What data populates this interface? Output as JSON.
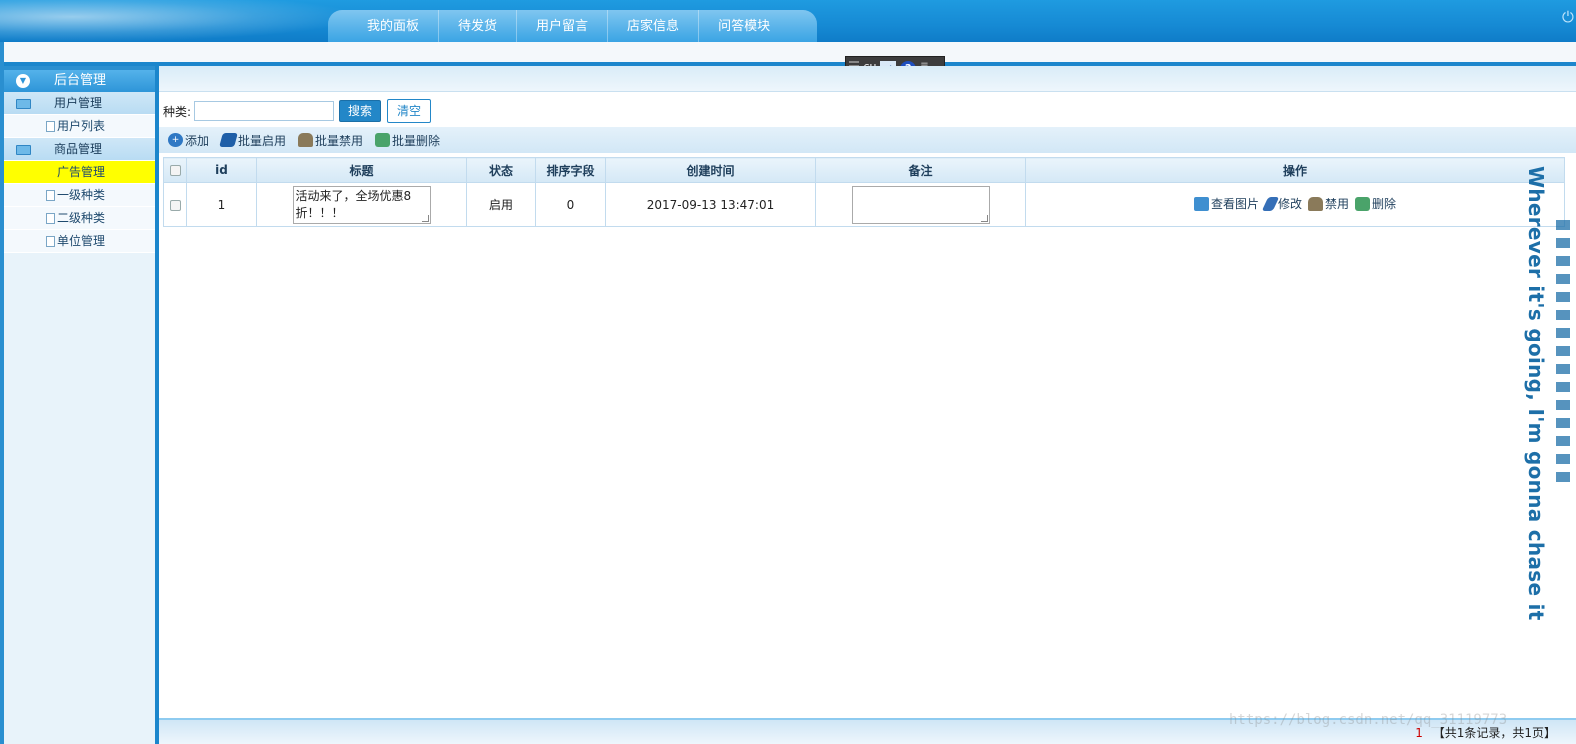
{
  "header": {
    "tabs": [
      "我的面板",
      "待发货",
      "用户留言",
      "店家信息",
      "问答模块"
    ],
    "power_icon": "power-icon"
  },
  "ime": {
    "label": "CH"
  },
  "sidebar": {
    "title": "后台管理",
    "items": [
      {
        "label": "用户管理",
        "type": "group"
      },
      {
        "label": "用户列表",
        "type": "leaf"
      },
      {
        "label": "商品管理",
        "type": "group"
      },
      {
        "label": "广告管理",
        "type": "leaf",
        "active": true
      },
      {
        "label": "一级种类",
        "type": "leaf"
      },
      {
        "label": "二级种类",
        "type": "leaf"
      },
      {
        "label": "单位管理",
        "type": "leaf"
      }
    ]
  },
  "search": {
    "label": "种类:",
    "value": "",
    "search_button": "搜索",
    "clear_button": "清空"
  },
  "toolbar": {
    "add": "添加",
    "batch_enable": "批量启用",
    "batch_disable": "批量禁用",
    "batch_delete": "批量删除"
  },
  "table": {
    "columns": [
      "id",
      "标题",
      "状态",
      "排序字段",
      "创建时间",
      "备注",
      "操作"
    ],
    "rows": [
      {
        "id": "1",
        "title": "活动来了，全场优惠8折！！！",
        "status": "启用",
        "sort": "0",
        "created": "2017-09-13 13:47:01",
        "remark": "",
        "actions": [
          "查看图片",
          "修改",
          "禁用",
          "删除"
        ]
      }
    ]
  },
  "pager": {
    "current": "1",
    "summary": "【共1条记录，共1页】"
  },
  "watermark": "https://blog.csdn.net/qq_31119773",
  "banner_text": "Wherever it's going, I'm gonna chase it",
  "colors": {
    "primary": "#2387c8",
    "active_item": "#ffff00",
    "header": "#168ad4"
  }
}
